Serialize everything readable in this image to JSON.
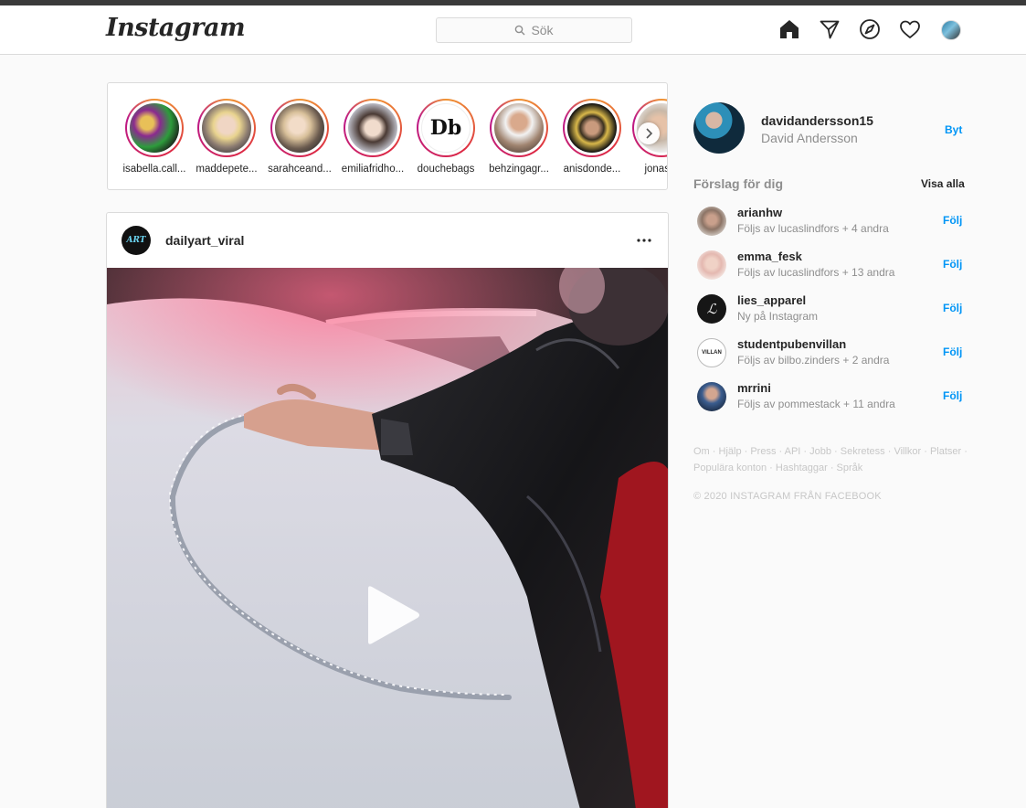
{
  "app": {
    "logo": "Instagram"
  },
  "search": {
    "placeholder": "Sök"
  },
  "nav": {
    "icons": [
      "home-icon",
      "direct-icon",
      "explore-icon",
      "activity-icon",
      "profile-avatar"
    ]
  },
  "stories": {
    "items": [
      {
        "name": "isabella.call..."
      },
      {
        "name": "maddepete..."
      },
      {
        "name": "sarahceand..."
      },
      {
        "name": "emiliafridho..."
      },
      {
        "name": "douchebags",
        "logo": "Db"
      },
      {
        "name": "behzingagr..."
      },
      {
        "name": "anisdonde..."
      },
      {
        "name": "jonasfa"
      }
    ]
  },
  "post": {
    "username": "dailyart_viral",
    "avatar_text": "ART",
    "more": "•••"
  },
  "profile": {
    "username": "davidandersson15",
    "fullname": "David Andersson",
    "switch": "Byt"
  },
  "suggestions": {
    "title": "Förslag för dig",
    "see_all": "Visa alla",
    "items": [
      {
        "username": "arianhw",
        "sub": "Följs av lucaslindfors + 4 andra",
        "action": "Följ"
      },
      {
        "username": "emma_fesk",
        "sub": "Följs av lucaslindfors + 13 andra",
        "action": "Följ"
      },
      {
        "username": "lies_apparel",
        "sub": "Ny på Instagram",
        "action": "Följ"
      },
      {
        "username": "studentpubenvillan",
        "sub": "Följs av bilbo.zinders + 2 andra",
        "action": "Följ"
      },
      {
        "username": "mrrini",
        "sub": "Följs av pommestack + 11 andra",
        "action": "Följ"
      }
    ]
  },
  "footer": {
    "links_line1": "Om · Hjälp · Press · API · Jobb · Sekretess · Villkor · Platser ·",
    "links_line2": "Populära konton · Hashtaggar · Språk",
    "copyright": "© 2020 INSTAGRAM FRÅN FACEBOOK"
  },
  "colors": {
    "accent": "#0095f6",
    "border": "#dbdbdb",
    "muted": "#8e8e8e"
  }
}
